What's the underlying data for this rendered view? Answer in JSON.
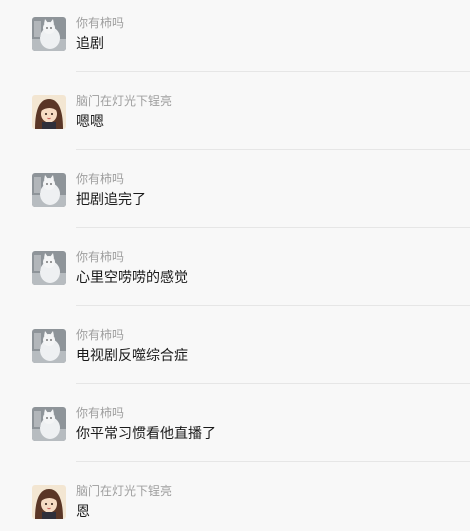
{
  "messages": [
    {
      "avatar": "cat-avatar",
      "name": "你有柿吗",
      "text": "追剧"
    },
    {
      "avatar": "girl-avatar",
      "name": "脑门在灯光下锃亮",
      "text": "嗯嗯"
    },
    {
      "avatar": "cat-avatar",
      "name": "你有柿吗",
      "text": "把剧追完了"
    },
    {
      "avatar": "cat-avatar",
      "name": "你有柿吗",
      "text": "心里空唠唠的感觉"
    },
    {
      "avatar": "cat-avatar",
      "name": "你有柿吗",
      "text": "电视剧反噬综合症"
    },
    {
      "avatar": "cat-avatar",
      "name": "你有柿吗",
      "text": "你平常习惯看他直播了"
    },
    {
      "avatar": "girl-avatar",
      "name": "脑门在灯光下锃亮",
      "text": "恩"
    }
  ]
}
